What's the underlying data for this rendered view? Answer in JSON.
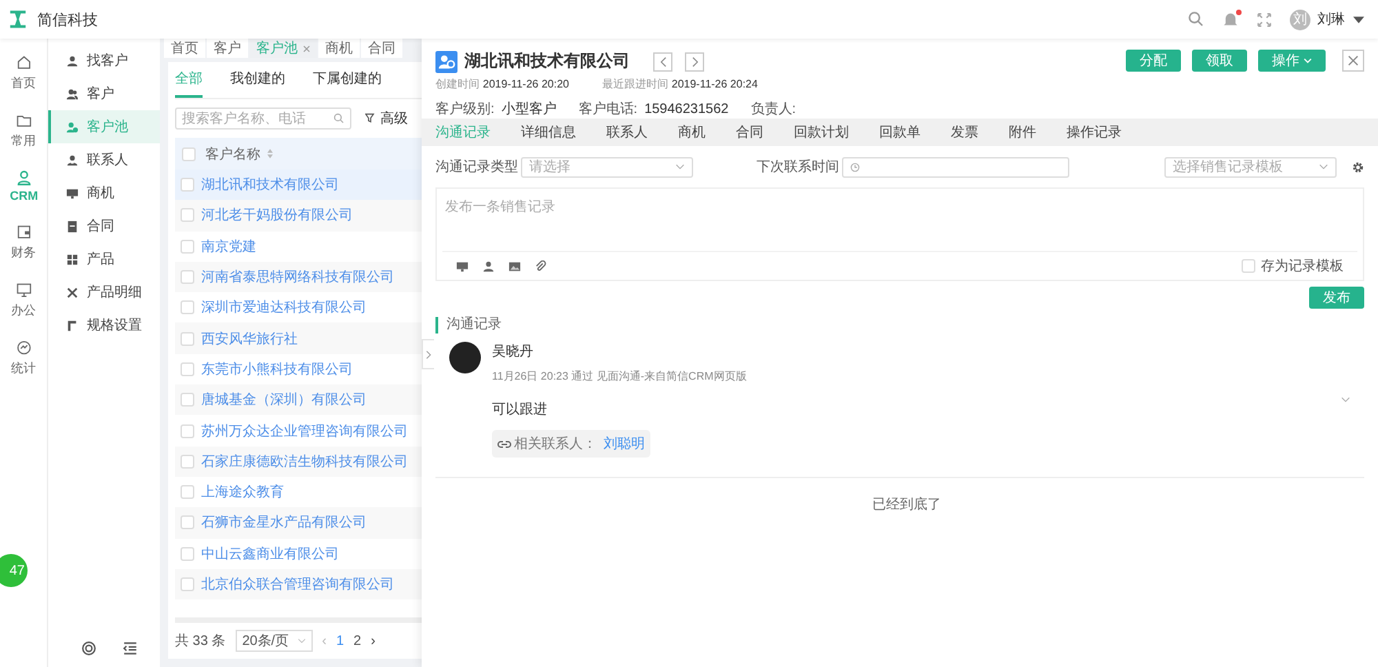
{
  "app": {
    "name": "简信科技"
  },
  "topbar": {
    "notifications_unread": true,
    "user": {
      "avatar_text": "刘",
      "name": "刘琳"
    }
  },
  "rail": [
    {
      "label": "首页",
      "selected": false
    },
    {
      "label": "常用",
      "selected": false
    },
    {
      "label": "CRM",
      "selected": true
    },
    {
      "label": "财务",
      "selected": false
    },
    {
      "label": "办公",
      "selected": false
    },
    {
      "label": "统计",
      "selected": false
    }
  ],
  "floating_badge": "47",
  "submenu": [
    {
      "label": "找客户",
      "selected": false
    },
    {
      "label": "客户",
      "selected": false
    },
    {
      "label": "客户池",
      "selected": true
    },
    {
      "label": "联系人",
      "selected": false
    },
    {
      "label": "商机",
      "selected": false
    },
    {
      "label": "合同",
      "selected": false
    },
    {
      "label": "产品",
      "selected": false
    },
    {
      "label": "产品明细",
      "selected": false
    },
    {
      "label": "规格设置",
      "selected": false
    }
  ],
  "page_tabs": [
    {
      "label": "首页",
      "selected": false,
      "closable": false
    },
    {
      "label": "客户",
      "selected": false,
      "closable": false
    },
    {
      "label": "客户池",
      "selected": true,
      "closable": true
    },
    {
      "label": "商机",
      "selected": false,
      "closable": false
    },
    {
      "label": "合同",
      "selected": false,
      "closable": false
    }
  ],
  "list": {
    "tabs": [
      {
        "label": "全部",
        "selected": true
      },
      {
        "label": "我创建的",
        "selected": false
      },
      {
        "label": "下属创建的",
        "selected": false
      }
    ],
    "search": {
      "placeholder": "搜索客户名称、电话"
    },
    "filter_label": "高级",
    "column": "客户名称",
    "all_checked": false,
    "rows": [
      {
        "name": "湖北讯和技术有限公司",
        "selected": true,
        "checked": false
      },
      {
        "name": "河北老干妈股份有限公司",
        "selected": false,
        "checked": false
      },
      {
        "name": "南京党建",
        "selected": false,
        "checked": false
      },
      {
        "name": "河南省泰思特网络科技有限公司",
        "selected": false,
        "checked": false
      },
      {
        "name": "深圳市爱迪达科技有限公司",
        "selected": false,
        "checked": false
      },
      {
        "name": "西安风华旅行社",
        "selected": false,
        "checked": false
      },
      {
        "name": "东莞市小熊科技有限公司",
        "selected": false,
        "checked": false
      },
      {
        "name": "唐城基金（深圳）有限公司",
        "selected": false,
        "checked": false
      },
      {
        "name": "苏州万众达企业管理咨询有限公司",
        "selected": false,
        "checked": false
      },
      {
        "name": "石家庄康德欧洁生物科技有限公司",
        "selected": false,
        "checked": false
      },
      {
        "name": "上海途众教育",
        "selected": false,
        "checked": false
      },
      {
        "name": "石狮市金星水产品有限公司",
        "selected": false,
        "checked": false
      },
      {
        "name": "中山云鑫商业有限公司",
        "selected": false,
        "checked": false
      },
      {
        "name": "北京伯众联合管理咨询有限公司",
        "selected": false,
        "checked": false
      }
    ],
    "pagination": {
      "total": "共 33 条",
      "page_size": "20条/页",
      "prev": "‹",
      "pages": [
        {
          "label": "1",
          "selected": true
        },
        {
          "label": "2",
          "selected": false
        }
      ],
      "next": "›"
    }
  },
  "detail": {
    "title": "湖北讯和技术有限公司",
    "meta": [
      {
        "label": "创建时间",
        "value": "2019-11-26 20:20"
      },
      {
        "label": "最近跟进时间",
        "value": "2019-11-26 20:24"
      }
    ],
    "fields": [
      {
        "label": "客户级别:",
        "value": "小型客户"
      },
      {
        "label": "客户电话:",
        "value": "15946231562"
      },
      {
        "label": "负责人:"
      }
    ],
    "buttons": [
      "分配",
      "领取",
      "操作"
    ],
    "tabs": [
      {
        "label": "沟通记录",
        "selected": true
      },
      {
        "label": "详细信息",
        "selected": false
      },
      {
        "label": "联系人",
        "selected": false
      },
      {
        "label": "商机",
        "selected": false
      },
      {
        "label": "合同",
        "selected": false
      },
      {
        "label": "回款计划",
        "selected": false
      },
      {
        "label": "回款单",
        "selected": false
      },
      {
        "label": "发票",
        "selected": false
      },
      {
        "label": "附件",
        "selected": false
      },
      {
        "label": "操作记录",
        "selected": false
      }
    ],
    "form": {
      "type_label": "沟通记录类型",
      "type_placeholder": "请选择",
      "next_label": "下次联系时间",
      "template_placeholder": "选择销售记录模板",
      "note_placeholder": "发布一条销售记录",
      "save_template": {
        "label": "存为记录模板",
        "checked": false
      },
      "submit": "发布"
    },
    "records_title": "沟通记录",
    "records": [
      {
        "author": "吴晓丹",
        "meta": "11月26日 20:23 通过 见面沟通-来自简信CRM网页版",
        "text": "可以跟进",
        "contact_label": "相关联系人：",
        "contact": "刘聪明"
      }
    ],
    "end_text": "已经到底了"
  }
}
